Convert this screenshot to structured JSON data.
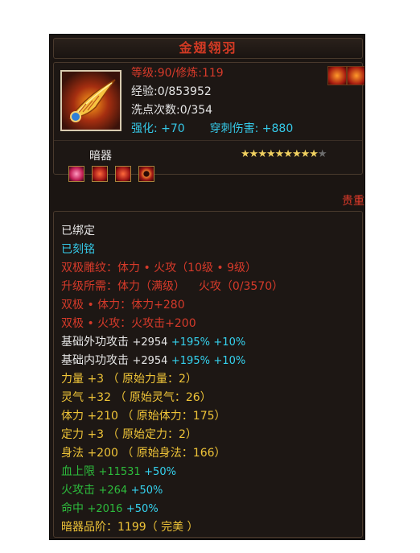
{
  "item": {
    "title": "金翅翎羽",
    "level_line": "等级:90/修炼:119",
    "exp_line": "经验:0/853952",
    "wash_line": "洗点次数:0/354",
    "enhance_label": "强化:",
    "enhance_value": "+70",
    "pierce_label": "穿刺伤害:",
    "pierce_value": "+880",
    "category": "暗器",
    "stars_filled": 9,
    "stars_total": 10,
    "valuable_label": "贵重",
    "gems": [
      "pink-gem-icon",
      "red-gem-icon",
      "red-gem-icon",
      "ring-gem-icon"
    ]
  },
  "details": {
    "bound": "已绑定",
    "engraved": "已刻铭",
    "dual_pattern": "双极雕纹：体力 • 火攻（10级 • 9级）",
    "upgrade_req_label": "升级所需：体力（满级）",
    "upgrade_req_value": "火攻（0/3570）",
    "dual_stamina": "双极 • 体力：体力+280",
    "dual_fire": "双极 • 火攻：火攻击+200",
    "ext_attack_label": "基础外功攻击",
    "ext_attack_value": "+2954",
    "ext_attack_pct1": "+195%",
    "ext_attack_pct2": "+10%",
    "int_attack_label": "基础内功攻击",
    "int_attack_value": "+2954",
    "int_attack_pct1": "+195%",
    "int_attack_pct2": "+10%",
    "strength": "力量 +3 （ 原始力量：2）",
    "spirit": "灵气 +32 （ 原始灵气：26）",
    "stamina": "体力 +210 （ 原始体力：175）",
    "focus": "定力 +3 （ 原始定力：2）",
    "agility": "身法 +200 （ 原始身法：166）",
    "hp_label": "血上限",
    "hp_value": "+11531",
    "hp_pct": "+50%",
    "fire_label": "火攻击",
    "fire_value": "+264",
    "fire_pct": "+50%",
    "hit_label": "命中",
    "hit_value": "+2016",
    "hit_pct": "+50%",
    "grade": "暗器品阶：1199（ 完美 ）"
  },
  "colors": {
    "background": "#1b1512",
    "title_red": "#d33a24",
    "text_red": "#d63a2a",
    "text_white": "#e6e6e6",
    "text_cyan": "#35c9e8",
    "text_yellow": "#efc438",
    "text_green": "#2dbb3c",
    "star_gold": "#f0d060"
  }
}
